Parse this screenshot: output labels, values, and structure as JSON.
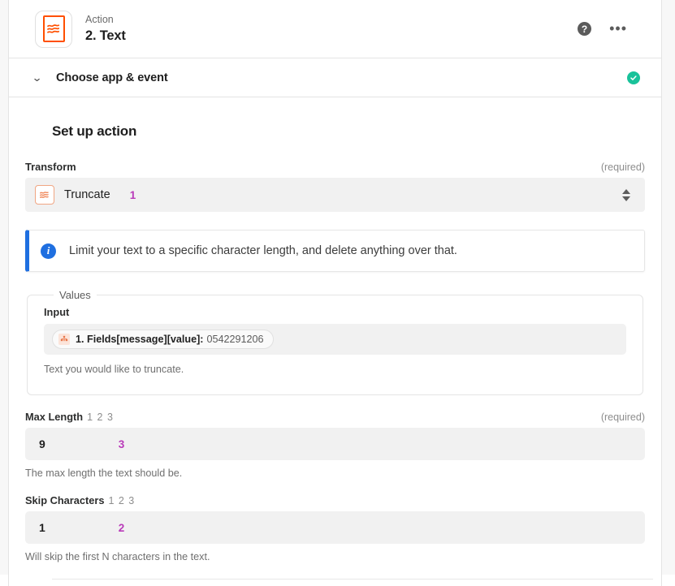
{
  "header": {
    "eyebrow": "Action",
    "title": "2. Text",
    "app_icon_name": "formatter-text-icon",
    "help_label": "?",
    "more_label": "•••"
  },
  "sections": [
    {
      "label": "Choose app & event",
      "state": "complete",
      "chevron": "⌄"
    }
  ],
  "setup": {
    "title": "Set up action",
    "transform": {
      "label": "Transform",
      "required_note": "(required)",
      "value": "Truncate",
      "annotation": "1"
    },
    "info": {
      "text": "Limit your text to a specific character length, and delete anything over that."
    },
    "values": {
      "legend": "Values",
      "input": {
        "label": "Input",
        "token_key": "1. Fields[message][value]:",
        "token_value": "0542291206",
        "helper": "Text you would like to truncate."
      }
    },
    "max_length": {
      "label": "Max Length",
      "type_hint": "1 2 3",
      "required_note": "(required)",
      "value": "9",
      "annotation": "3",
      "helper": "The max length the text should be."
    },
    "skip_characters": {
      "label": "Skip Characters",
      "type_hint": "1 2 3",
      "value": "1",
      "annotation": "2",
      "helper": "Will skip the first N characters in the text."
    }
  },
  "colors": {
    "brand_orange": "#ff4f00",
    "info_blue": "#1f6fe0",
    "success_green": "#19c29a",
    "annotation_purple": "#b93ab9"
  }
}
